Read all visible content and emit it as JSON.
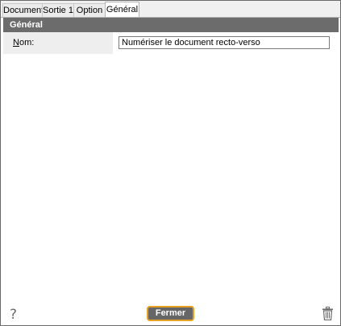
{
  "tabs": [
    {
      "label": "Document",
      "active": false
    },
    {
      "label": "Sortie 1",
      "active": false
    },
    {
      "label": "Option",
      "active": false
    },
    {
      "label": "Général",
      "active": true
    }
  ],
  "section": {
    "title": "Général"
  },
  "form": {
    "name_label_accel": "N",
    "name_label_rest": "om:",
    "name_value": "Numériser le document recto-verso"
  },
  "footer": {
    "help_glyph": "?",
    "close_label": "Fermer",
    "help_icon": "help-icon",
    "delete_icon": "trash-icon"
  },
  "colors": {
    "header_bg": "#6c6c6c",
    "button_bg": "#666666",
    "button_border": "#e8a020"
  }
}
